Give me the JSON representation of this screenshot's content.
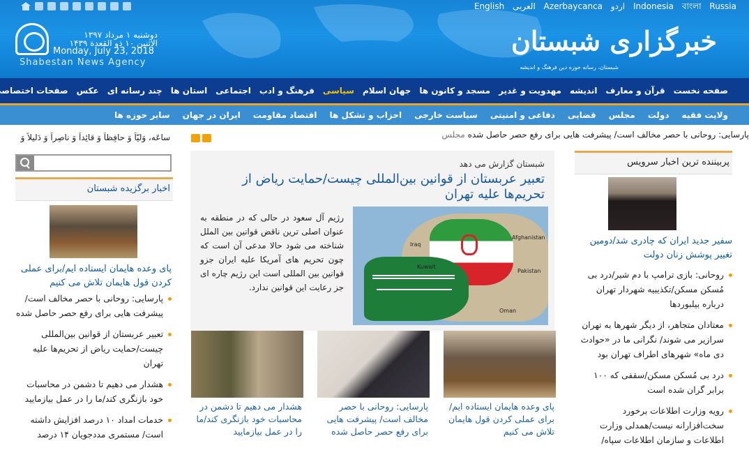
{
  "header": {
    "languages": [
      "Russia",
      "বাংলা",
      "Indonesia",
      "اردو",
      "Azerbaycanca",
      "العربی",
      "English"
    ],
    "date_fa": "دوشنبه ۱ مرداد ۱۳۹۷",
    "date_ar": "الاثنین ۱۰ ذو القعدة ۱۴۳۹",
    "date_en": "Monday, July 23, 2018",
    "agency_en": "Shabestan News Agency",
    "brand_fa": "خبرگزاری شبستان",
    "tagline_fa": "شبستان، رسانه حوزه دین فرهنگ و اندیشه"
  },
  "nav_primary": [
    "صفحه نخست",
    "قرآن و معارف",
    "اندیشه",
    "مهدویت و غدیر",
    "مسجد و کانون ها",
    "جهان اسلام",
    "سیاسی",
    "فرهنگ و ادب",
    "اجتماعی",
    "استان ها",
    "چند رسانه ای",
    "عکس",
    "صفحات اختصاصی"
  ],
  "nav_secondary": [
    "ولایت فقیه",
    "دولت",
    "مجلس",
    "قضایی",
    "دفاعی و امنیتی",
    "سیاست خارجی",
    "احزاب و تشکل ها",
    "اقتصاد مقاومت",
    "ایران در جهان",
    "سایر حوزه ها"
  ],
  "left": {
    "ticker": "ٌ ساعَه، وَلیّاً وَ حافِظاً وَ قائِداً وَ ناصِراً وَ دَلیلاً وَ",
    "section_title": "اخبار برگزیده شبستان",
    "lead_title": "پای وعده هایمان ایستاده ایم/برای عملی کردن قول هایمان تلاش می کنیم",
    "items": [
      "پارسایی: روحانی با حصر مخالف است/ پیشرفت هایی برای رفع حصر حاصل شده",
      "تعبیر عربستان از قوانین بین‌المللی چیست/حمایت ریاض از تحریم‌ها علیه تهران",
      "هشدار می دهیم تا دشمن در محاسبات خود بازنگری کند/ما را در عمل بیازمایید",
      "خدمات امداد ۱۰ درصد افزایش داشته است/ مستمری مددجویان ۱۴ درصد"
    ]
  },
  "breaking": {
    "text": "پارسایی: روحانی با حصر مخالف است/ پیشرفت هایی برای رفع حصر حاصل شده",
    "label": "مجلس"
  },
  "featured": {
    "kicker": "شبستان گزارش می دهد",
    "title": "تعبیر عربستان از قوانین بین‌المللی چیست/حمایت ریاض از تحریم‌ها علیه تهران",
    "body": "رژیم آل سعود در حالی که در منطقه به عنوان اصلی ترین ناقض قوانین بین الملل شناخته می شود حالا مدعی آن است که چون تحریم های آمریکا علیه ایران جزو قوانین بین المللی است این رژیم چاره ای جز رعایت این قوانین ندارد.",
    "map_labels": [
      "Iraq",
      "Afghanistan",
      "Pakistan",
      "Oman",
      "Kuwait"
    ]
  },
  "cards": [
    {
      "title": "پای وعده هایمان ایستاده ایم/برای عملی کردن قول هایمان تلاش می کنیم"
    },
    {
      "title": "پارسایی: روحانی با حصر مخالف است/ پیشرفت هایی برای رفع حصر حاصل شده"
    },
    {
      "title": "هشدار می دهیم تا دشمن در محاسبات خود بازنگری کند/ما را در عمل بیازمایید"
    }
  ],
  "right": {
    "section_title": "پربیننده ترین اخبار سرویس",
    "lead_title": "سفیر جدید ایران که چادری شد/دومین تغییر پوشش زنان دولت",
    "items": [
      "روحانی: بازی ترامپ با دم شیر/درد بی مُسکن مسکن/تکذیبیه شهردار تهران درباره بیلبوردها",
      "معتادان متجاهر، از دیگر شهرها به تهران سرازیر می شوند/ نگرانی ما در «حوادث دی ماه» شهرهای اطراف تهران بود",
      "درد بی مُسکن مسکن/سقفی که ۱۰۰ برابر گران شده است",
      "رویه وزارت اطلاعات برخورد سخت‌افزارانه نیست/همدلی وزارت اطلاعات و سازمان اطلاعات سپاه/هدفمان برخورد با ریشه"
    ]
  }
}
